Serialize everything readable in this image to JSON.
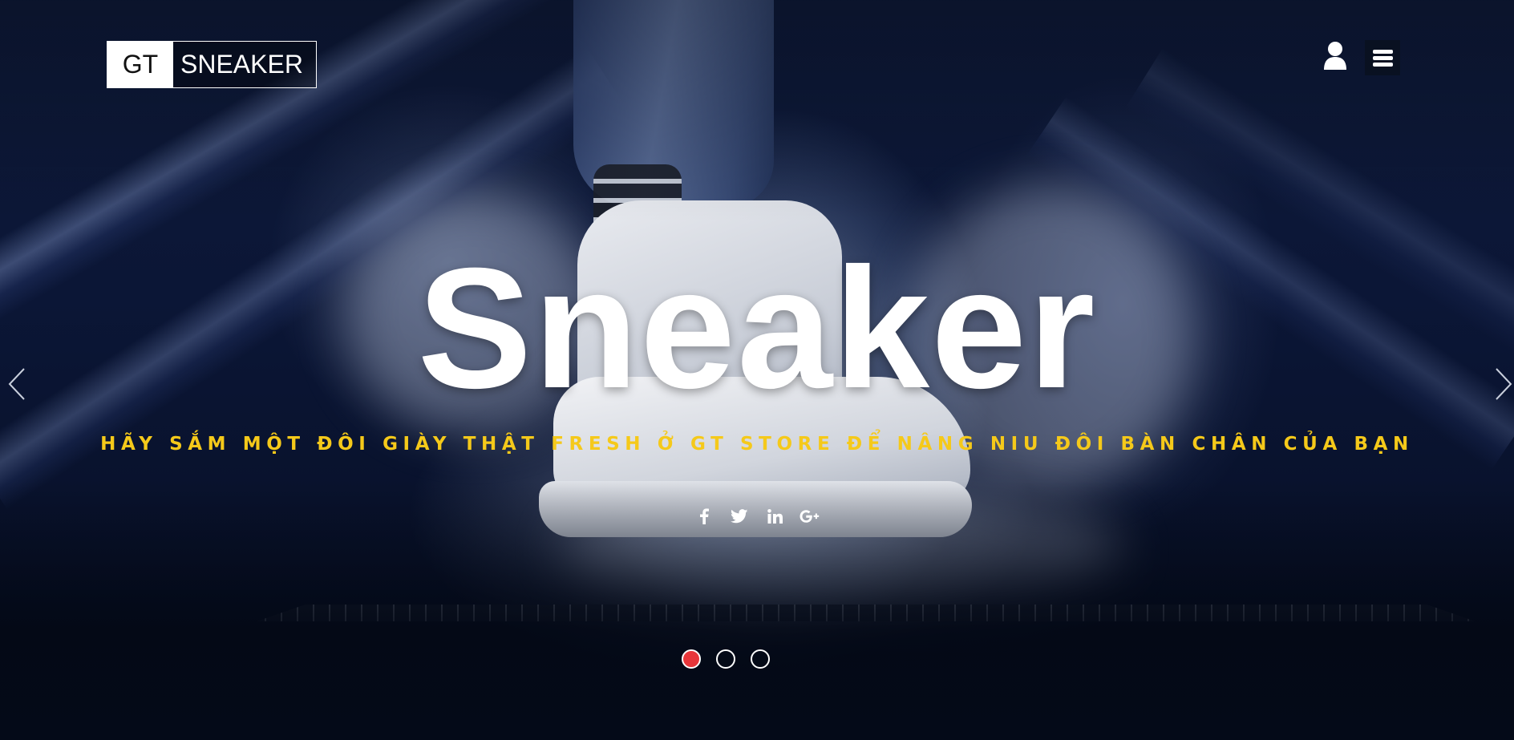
{
  "header": {
    "logo": {
      "part1": "GT",
      "part2": "SNEAKER"
    },
    "user_icon": "user-icon",
    "menu_icon": "hamburger-menu-icon"
  },
  "hero": {
    "headline": "Sneaker",
    "tagline": "HÃY SẮM MỘT ĐÔI GIÀY THẬT FRESH Ở GT STORE ĐỂ NÂNG NIU ĐÔI BÀN CHÂN CỦA BẠN",
    "tagline_color": "#f5c91a",
    "social": [
      {
        "icon": "facebook-icon",
        "glyph": "f"
      },
      {
        "icon": "twitter-icon",
        "glyph": "🐦"
      },
      {
        "icon": "linkedin-icon",
        "glyph": "in"
      },
      {
        "icon": "google-plus-icon",
        "glyph": "G+"
      }
    ]
  },
  "carousel": {
    "slide_count": 3,
    "active_index": 0,
    "active_color": "#e8363a",
    "prev_icon": "chevron-left-icon",
    "next_icon": "chevron-right-icon"
  }
}
